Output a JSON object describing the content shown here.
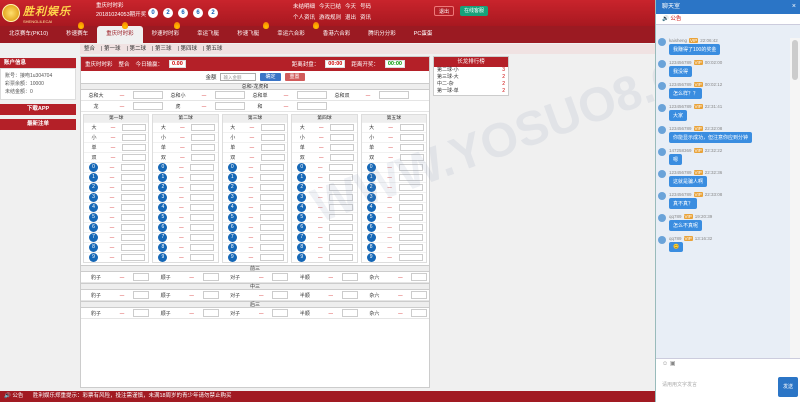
{
  "header": {
    "brand": "胜利娱乐",
    "brand_sub": "SHENGLILECAI",
    "draw_name": "重庆时时彩",
    "draw_period": "20181024053期开奖",
    "numbers": [
      "0",
      "2",
      "6",
      "6",
      "2"
    ],
    "links": [
      "未结明细",
      "今天已结",
      "今天",
      "号码",
      "个人资讯",
      "游戏规则",
      "退出",
      "资讯"
    ],
    "exit": "退出",
    "service": "在线客服"
  },
  "nav": [
    "北京赛车(PK10)",
    "秒速赛车",
    "重庆时时彩",
    "秒速时时彩",
    "幸运飞艇",
    "秒速飞艇",
    "幸运六合彩",
    "香港六合彩",
    "腾讯分分彩",
    "PC蛋蛋"
  ],
  "left": {
    "title": "账户信息",
    "account": "账号：接吻1u304704",
    "balance": "彩票余额：10000",
    "unsettled": "未结金额：0",
    "app": "下载APP",
    "notes": "最新注单"
  },
  "subnav": [
    "整合",
    "第一球",
    "第二球",
    "第三球",
    "第四球",
    "第五球"
  ],
  "main": {
    "title": "重庆时时彩",
    "mode": "整合",
    "profit_label": "今日输赢：",
    "profit": "0.00",
    "close_label": "距离封盘：",
    "close_time": "00:00",
    "open_label": "距离开奖：",
    "open_time": "00:00",
    "amount_label": "金额",
    "amount_ph": "输入金额",
    "confirm": "确定",
    "reset": "重置",
    "sum_title": "总和-龙虎和",
    "sum_rows": [
      [
        "总和大",
        "—",
        "总和小",
        "—",
        "总和单",
        "—",
        "总和双",
        "—"
      ],
      [
        "龙",
        "—",
        "虎",
        "—",
        "和",
        "—",
        "",
        ""
      ]
    ],
    "ball_cols": [
      "第一球",
      "第二球",
      "第三球",
      "第四球",
      "第五球"
    ],
    "ball_attrs": [
      "大",
      "小",
      "单",
      "双"
    ],
    "digits": [
      "0",
      "1",
      "2",
      "3",
      "4",
      "5",
      "6",
      "7",
      "8",
      "9"
    ],
    "three_secs": [
      "前三",
      "中三",
      "后三"
    ],
    "three_items": [
      "豹子",
      "顺子",
      "对子",
      "半顺",
      "杂六"
    ],
    "odd": "—"
  },
  "rank": {
    "title": "长龙排行榜",
    "rows": [
      [
        "第二球-小",
        "3"
      ],
      [
        "第三球-大",
        "2"
      ],
      [
        "中二-杂",
        "2"
      ],
      [
        "第一球-单",
        "2"
      ]
    ]
  },
  "footer": {
    "label": "公告",
    "text": "胜利娱乐郑重提示：彩票有风险，投注需谨慎，未满18周岁的青少年请勿禁止购买"
  },
  "chat": {
    "title": "聊天室",
    "tab": "公告",
    "input_ph": "请用用文字发言",
    "send": "发送",
    "messages": [
      {
        "user": "kaisheng",
        "badge": "VIP",
        "time": "22:06:42",
        "text": "我赚得了100的奖金"
      },
      {
        "user": "123456789",
        "badge": "VIP",
        "time": "00:02:00",
        "text": "我没得"
      },
      {
        "user": "123456789",
        "badge": "VIP",
        "time": "00:02:12",
        "text": "怎么样？？"
      },
      {
        "user": "123456789",
        "badge": "VIP",
        "time": "22:31:41",
        "text": "大家"
      },
      {
        "user": "123456789",
        "badge": "VIP",
        "time": "22:32:08",
        "text": "你能显示成功，但注意你应到分钟"
      },
      {
        "user": "147258369",
        "badge": "VIP",
        "time": "22:32:22",
        "text": "嗯"
      },
      {
        "user": "123456789",
        "badge": "VIP",
        "time": "22:32:36",
        "text": "这就是骗人啊"
      },
      {
        "user": "123456789",
        "badge": "VIP",
        "time": "22:33:08",
        "text": "真不真？"
      },
      {
        "user": "qq789",
        "badge": "VIP",
        "time": "19:20:39",
        "text": "怎么不真呢"
      },
      {
        "user": "qq789",
        "badge": "VIP",
        "time": "13:16:32",
        "text": "😊"
      }
    ]
  }
}
